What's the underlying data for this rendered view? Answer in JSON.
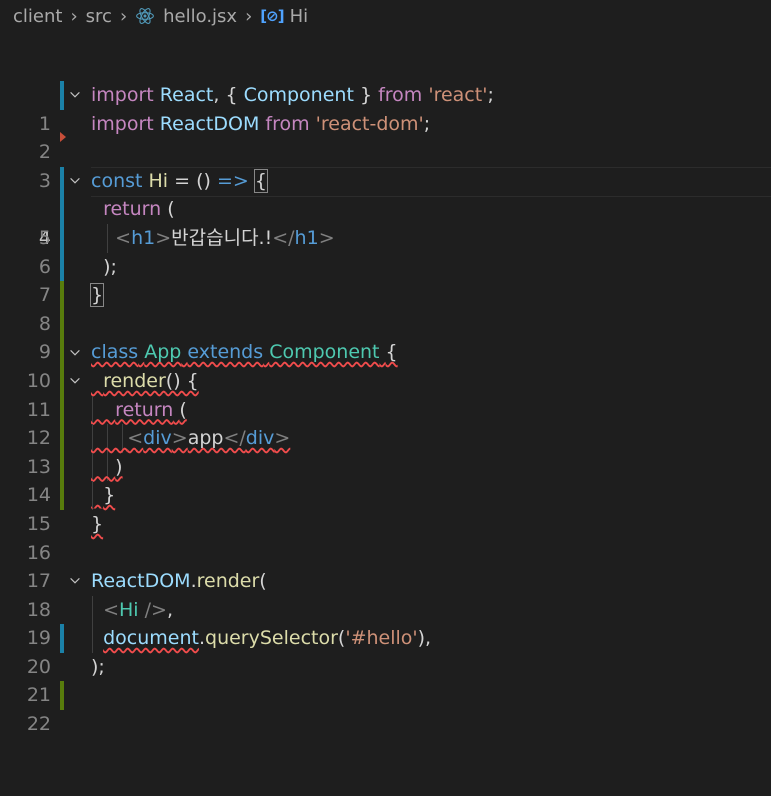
{
  "breadcrumb": {
    "parts": [
      "client",
      "src",
      "hello.jsx",
      "Hi"
    ],
    "icons": [
      "react-icon",
      "symbol-function-icon"
    ]
  },
  "colors": {
    "background": "#1e1e1e",
    "keyword": "#c586c0",
    "storage": "#569cd6",
    "string": "#ce9178",
    "variable": "#9cdcfe",
    "function": "#dcdcaa",
    "class": "#4ec9b0",
    "modified_bar": "#1b81a8",
    "added_bar": "#587c0c",
    "error_squiggle": "#f14c4c"
  },
  "editor": {
    "line_numbers": [
      "1",
      "2",
      "3",
      "4",
      "5",
      "6",
      "7",
      "8",
      "9",
      "10",
      "11",
      "12",
      "13",
      "14",
      "15",
      "16",
      "17",
      "18",
      "19",
      "20",
      "21",
      "22"
    ],
    "line1": {
      "import": "import",
      "react": "React",
      "c1": ",",
      "ob": "{",
      "component": "Component",
      "cb": "}",
      "from": "from",
      "str": "'react'",
      "semi": ";"
    },
    "line2": {
      "import": "import",
      "reactdom": "ReactDOM",
      "from": "from",
      "str": "'react-dom'",
      "semi": ";"
    },
    "line4": {
      "const": "const",
      "name": "Hi",
      "eq": "=",
      "params": "()",
      "arrow": "=>",
      "brace": "{"
    },
    "line5": {
      "return": "return",
      "paren": "("
    },
    "line6": {
      "lt1": "<",
      "tag1": "h1",
      "gt1": ">",
      "text": "반갑습니다.!",
      "lt2": "</",
      "tag2": "h1",
      "gt2": ">"
    },
    "line7": {
      "close": ");"
    },
    "line8": {
      "brace": "}"
    },
    "line10": {
      "class": "class",
      "name": "App",
      "extends": "extends",
      "base": "Component",
      "brace": "{"
    },
    "line11": {
      "method": "render",
      "rest": "() {"
    },
    "line12": {
      "return": "return",
      "paren": "("
    },
    "line13": {
      "lt1": "<",
      "tag1": "div",
      "gt1": ">",
      "text": "app",
      "lt2": "</",
      "tag2": "div",
      "gt2": ">"
    },
    "line14": {
      "paren": ")"
    },
    "line15": {
      "brace": "}"
    },
    "line16": {
      "brace": "}"
    },
    "line18": {
      "obj": "ReactDOM",
      "dot": ".",
      "fn": "render",
      "paren": "("
    },
    "line19": {
      "lt": "<",
      "tag": "Hi",
      "close": " />",
      "comma": ","
    },
    "line20": {
      "doc": "document",
      "dot": ".",
      "fn": "querySelector",
      "op": "(",
      "str": "'#hello'",
      "cl": "),"
    },
    "line21": {
      "close": ");"
    }
  }
}
